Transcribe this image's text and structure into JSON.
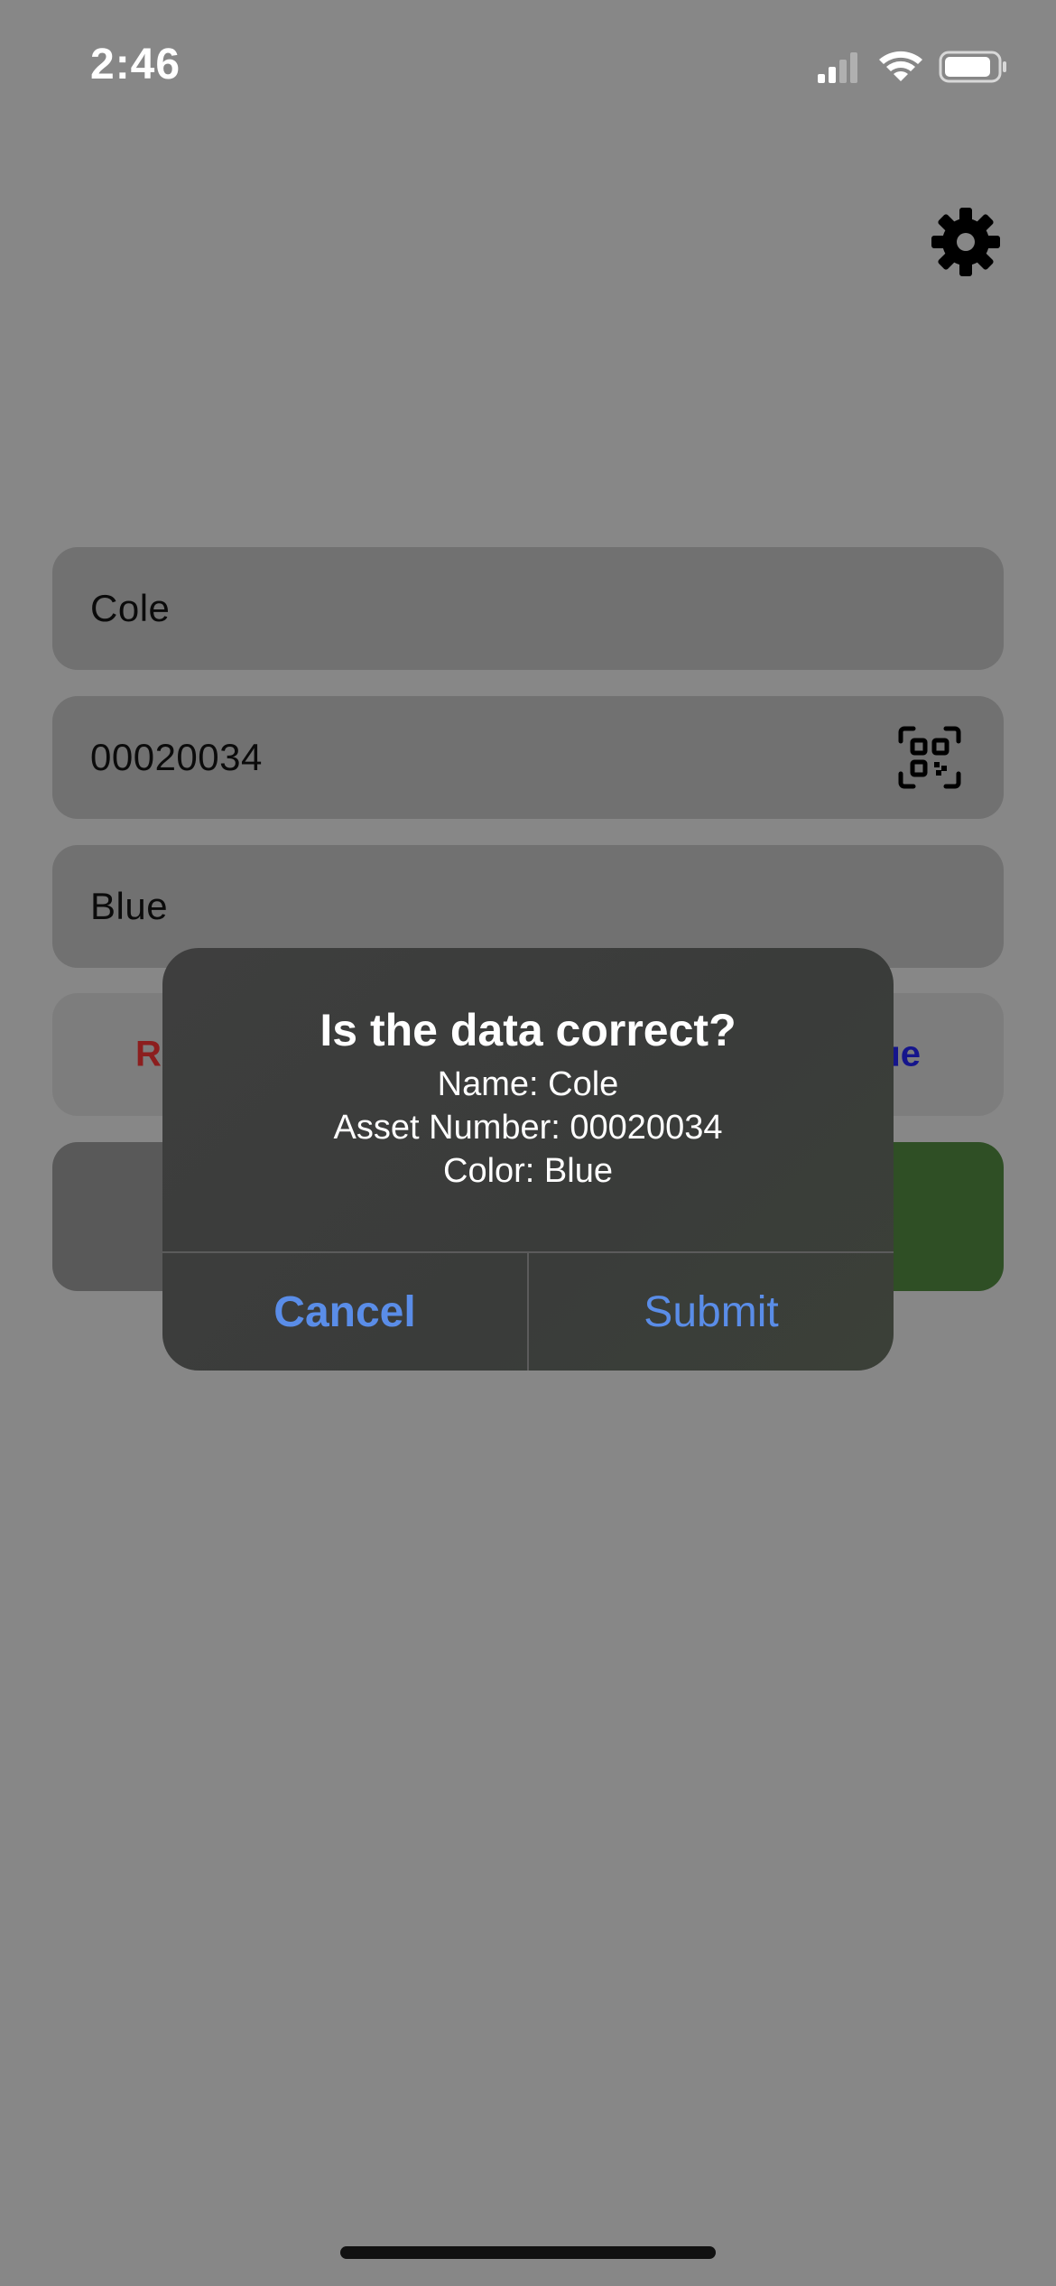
{
  "status_bar": {
    "time": "2:46",
    "signal_icon": "cellular-signal-icon",
    "wifi_icon": "wifi-icon",
    "battery_icon": "battery-icon"
  },
  "toolbar": {
    "settings_icon": "gear-icon"
  },
  "form": {
    "name_value": "Cole",
    "asset_number_value": "00020034",
    "qr_icon": "qr-code-icon",
    "color_value": "Blue",
    "color_options": [
      {
        "label_visible": "R",
        "color": "#8c1e1e"
      },
      {
        "label_visible": "ue",
        "color": "#15158c"
      }
    ]
  },
  "alert": {
    "title": "Is the data correct?",
    "name_line": "Name: Cole",
    "asset_line": "Asset Number: 00020034",
    "color_line": "Color: Blue",
    "cancel_label": "Cancel",
    "submit_label": "Submit"
  },
  "colors": {
    "background_dimmed": "#878787",
    "alert_bg": "#3e3e3e",
    "action_blue": "#5a8de8",
    "submit_green": "#2f4f25"
  }
}
